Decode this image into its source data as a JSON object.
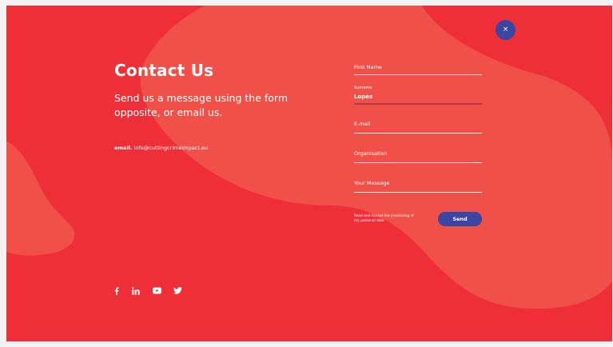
{
  "close_label": "×",
  "heading": "Contact Us",
  "subtitle": "Send us a message using the form opposite, or email us.",
  "email": {
    "label": "email.",
    "address": "info@cuttingcrimeimpact.eu"
  },
  "form": {
    "first_name_label": "First Name",
    "surname_label": "Surname",
    "surname_value": "Lopes",
    "email_label": "E-mail",
    "organisation_label": "Organisation",
    "message_label": "Your Message",
    "consent": "Read and Accept the processing of my personal data",
    "send_label": "Send"
  },
  "social_icons": [
    "facebook-icon",
    "linkedin-icon",
    "youtube-icon",
    "twitter-icon"
  ],
  "colors": {
    "background": "#ef2f37",
    "blob": "#f05048",
    "accent": "#3b45a3",
    "text": "#ffffff"
  }
}
